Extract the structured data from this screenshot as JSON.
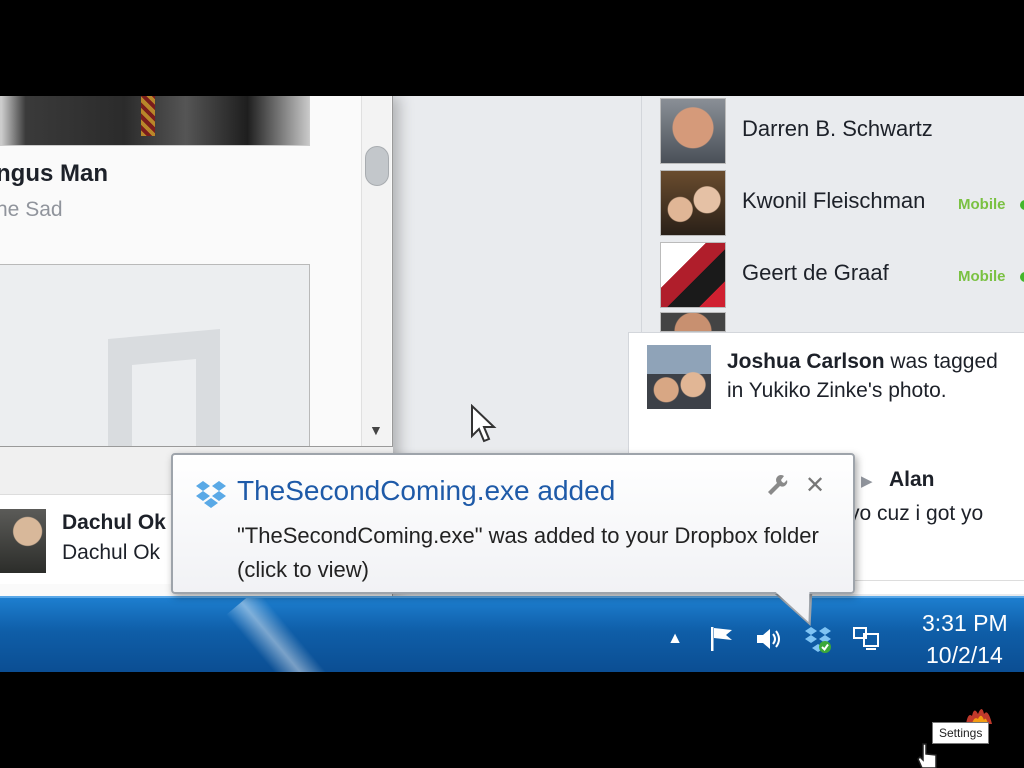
{
  "left_panel": {
    "profile_name": "ngus Man",
    "profile_sub": "he Sad"
  },
  "notification_dachul": {
    "name": "Dachul Ok",
    "text": "Dachul Ok"
  },
  "chat_contacts": [
    {
      "name": "Darren B. Schwartz",
      "mobile": ""
    },
    {
      "name": "Kwonil Fleischman",
      "mobile": "Mobile"
    },
    {
      "name": "Geert de Graaf",
      "mobile": "Mobile"
    }
  ],
  "notification_joshua": {
    "name": "Joshua Carlson",
    "text": "was tagged in Yukiko Zinke's photo."
  },
  "message_alan": {
    "name": "Alan",
    "text": "yo cuz i got yo"
  },
  "balloon": {
    "title": "TheSecondComing.exe added",
    "body": "\"TheSecondComing.exe\" was added to your Dropbox folder (click to view)"
  },
  "taskbar": {
    "time": "3:31 PM",
    "date": "10/2/14"
  },
  "tooltip": {
    "settings": "Settings"
  },
  "colors": {
    "taskbar": "#0f5ea8",
    "balloon_title": "#1e5aa8",
    "online_green": "#42b72a"
  }
}
